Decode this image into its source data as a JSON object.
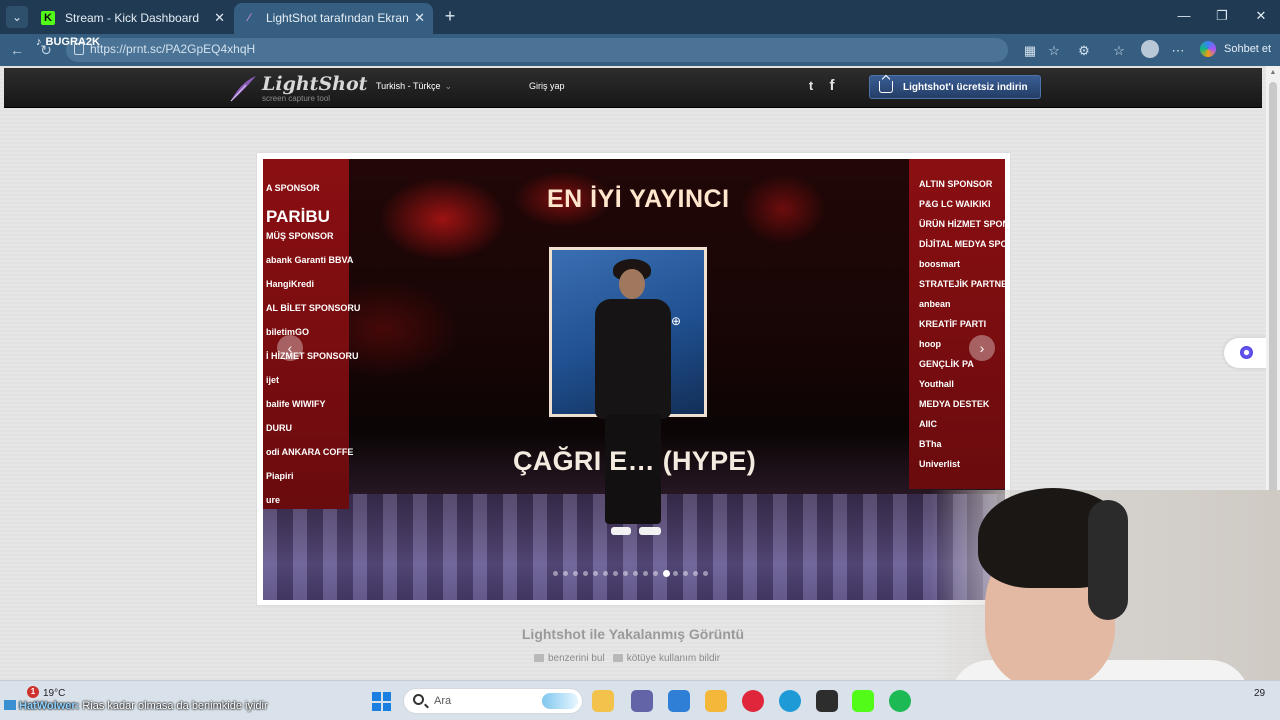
{
  "browser": {
    "tabs": [
      {
        "title": "Stream - Kick Dashboard",
        "favicon": "kick-favicon",
        "favicon_glyph": "K",
        "active": false
      },
      {
        "title": "LightShot tarafından Ekran Görünt",
        "favicon": "lightshot-feather-favicon",
        "favicon_glyph": "⁄",
        "active": true
      }
    ],
    "tab_menu_glyph": "⌄",
    "close_glyph": "✕",
    "new_tab_glyph": "+",
    "window_controls": {
      "minimize": "—",
      "maximize": "❐",
      "close": "✕"
    },
    "nav": {
      "back": "←",
      "refresh": "↻"
    },
    "url": "https://prnt.sc/PA2GpEQ4xhqH",
    "overlay_handle": "BUGRA2K",
    "overlay_handle_glyph": "♪",
    "toolbar_icons": [
      {
        "name": "apps-icon",
        "glyph": "▦"
      },
      {
        "name": "favorite-star-icon",
        "glyph": "☆"
      },
      {
        "name": "extensions-icon",
        "glyph": "⚙"
      },
      {
        "name": "favorites-icon",
        "glyph": "☆"
      },
      {
        "name": "more-icon",
        "glyph": "⋯"
      }
    ],
    "chat_label": "Sohbet et"
  },
  "lightshot": {
    "logo_text": "LightShot",
    "logo_subtitle": "screen capture tool",
    "language": "Turkish - Türkçe",
    "language_caret": "⌄",
    "login": "Giriş yap",
    "social": {
      "twitter": "t",
      "facebook": "f"
    },
    "download_button": "Lightshot'ı ücretsiz indirin",
    "caption_title": "Lightshot ile Yakalanmış Görüntü",
    "link_similar": "benzerini bul",
    "link_report": "kötüye kullanım bildir"
  },
  "screenshot": {
    "headline": "EN İYİ YAYINCI",
    "caption": "ÇAĞRI E… (HYPE)",
    "carousel_prev": "‹",
    "carousel_next": "›",
    "active_slide": 11,
    "slide_count": 16,
    "left_sponsors": [
      "A SPONSOR",
      "PARİBU",
      "MÜŞ SPONSOR",
      "abank  Garanti BBVA",
      "HangiKredi",
      "AL BİLET SPONSORU",
      "biletimGO",
      "İ HİZMET SPONSORU",
      "ijet",
      "balife   WIWIFY",
      "DURU",
      "odi  ANKARA COFFE",
      "Piapiri",
      "ure"
    ],
    "right_sponsors": [
      "ALTIN SPONSOR",
      "P&G  LC WAIKIKI",
      "ÜRÜN HİZMET SPONSOR",
      "DİJİTAL MEDYA SPONSO",
      "boosmart",
      "STRATEJİK PARTNE",
      "anbean",
      "KREATİF PARTI",
      "hoop",
      "GENÇLİK PA",
      "Youthall",
      "MEDYA DESTEK",
      "AIIC",
      "BTha",
      "Univerlist"
    ]
  },
  "taskbar": {
    "weather_alert": "1",
    "temperature": "19°C",
    "search_placeholder": "Ara",
    "overlay_user": "HatWolwer:",
    "overlay_message": "Rias kadar olmasa da benimkide iyidir",
    "clock_fragment": "29",
    "apps": [
      {
        "name": "file-explorer-icon",
        "color": "#f2c24b"
      },
      {
        "name": "teams-icon",
        "color": "#6264a7"
      },
      {
        "name": "store-icon",
        "color": "#2f7fd6"
      },
      {
        "name": "folder-icon",
        "color": "#f3b83a"
      },
      {
        "name": "opera-icon",
        "color": "#e0263a"
      },
      {
        "name": "edge-icon",
        "color": "#1e9bd7"
      },
      {
        "name": "obs-icon",
        "color": "#2d2d2d"
      },
      {
        "name": "kick-app-icon",
        "color": "#53fc18"
      },
      {
        "name": "spotify-icon",
        "color": "#1db954"
      }
    ]
  },
  "colors": {
    "browser_chrome": "#1f3a52",
    "active_tab": "#355e81",
    "page_background": "#e6e6e6",
    "download_button": "#2f4f80",
    "stage_red": "#8a0f12"
  }
}
